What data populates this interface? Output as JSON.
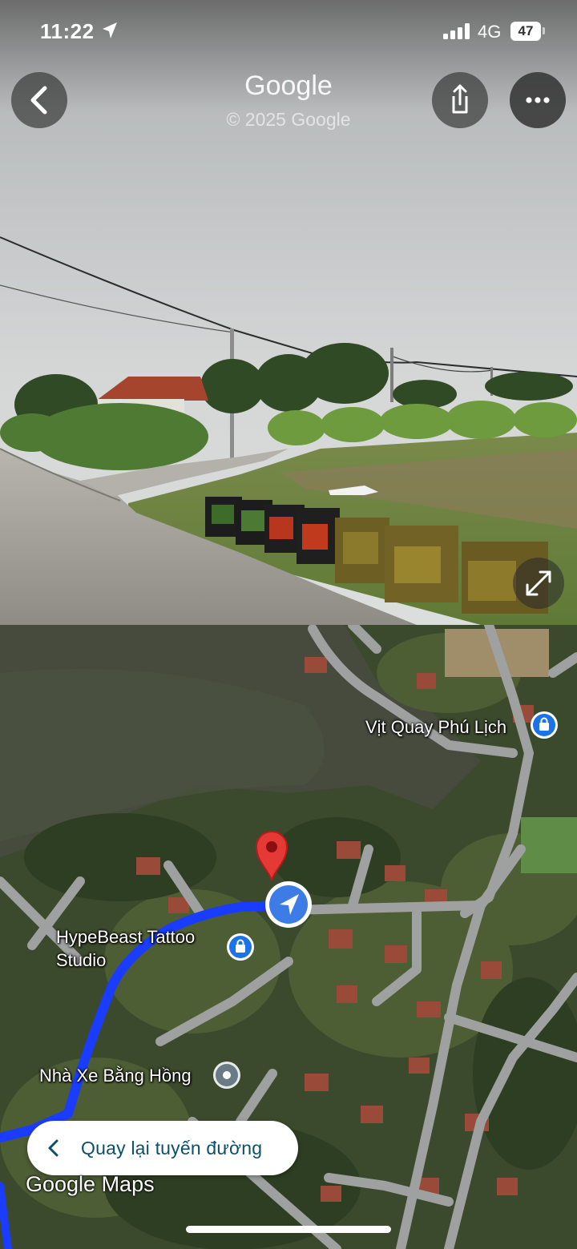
{
  "status_bar": {
    "time": "11:22",
    "network": "4G",
    "battery": "47"
  },
  "street_view": {
    "title": "Google",
    "copyright": "© 2025 Google",
    "buttons": {
      "back": "back-arrow-icon",
      "share": "share-icon",
      "more": "more-horizontal-icon",
      "expand": "expand-icon"
    }
  },
  "map": {
    "places": [
      {
        "name": "Vịt Quay Phú Lịch",
        "icon": "shopping-bag-icon"
      },
      {
        "name_line1": "HypeBeast Tattoo",
        "name_line2": "Studio",
        "icon": "shopping-bag-icon"
      },
      {
        "name": "Nhà Xe Bằng Hồng",
        "icon": "place-dot-icon"
      }
    ],
    "back_to_route": "Quay lại tuyến đường",
    "logo": "Google Maps",
    "colors": {
      "route": "#1a3cff",
      "pin": "#e53935",
      "poi_shop": "#1a73e8",
      "poi_generic": "#6b7b86"
    }
  }
}
